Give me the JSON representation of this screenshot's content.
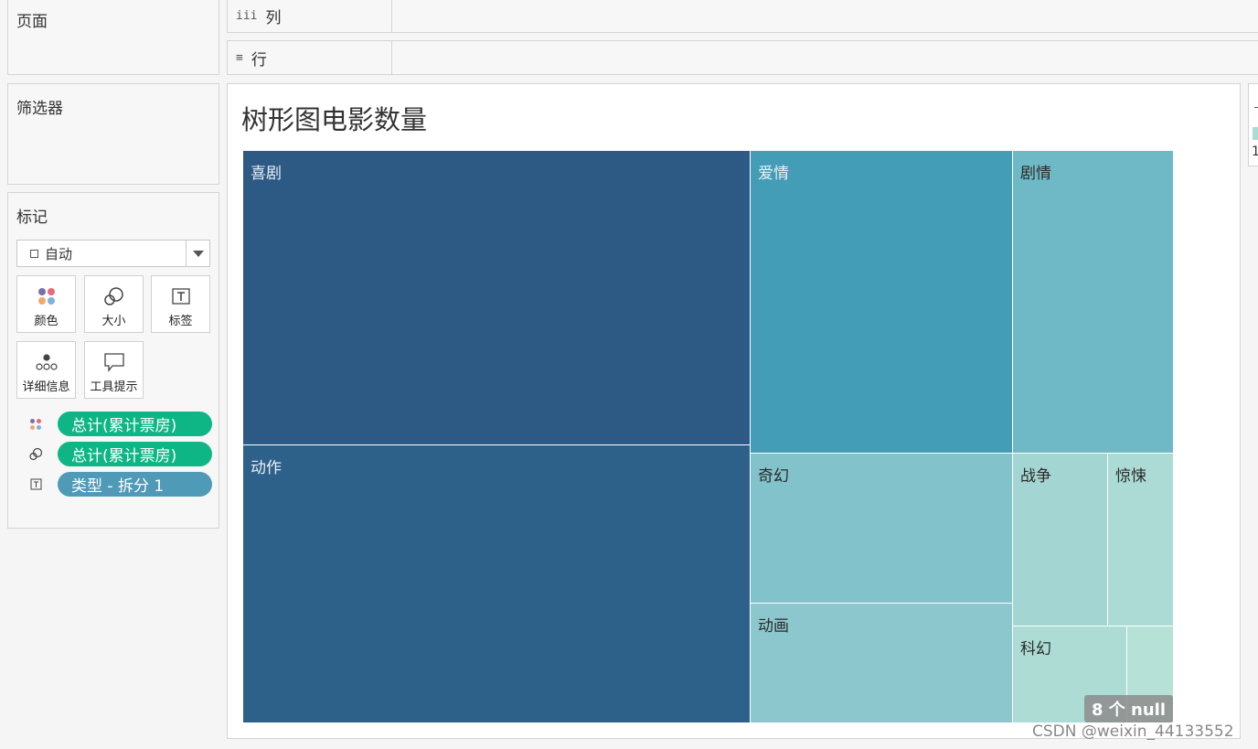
{
  "panels": {
    "pages": "页面",
    "filters": "筛选器",
    "marks": "标记"
  },
  "shelves": {
    "columns": "列",
    "rows": "行"
  },
  "marks": {
    "type": "自动",
    "buttons": [
      "颜色",
      "大小",
      "标签",
      "详细信息",
      "工具提示"
    ],
    "fields": [
      {
        "label": "总计(累计票房)",
        "kind": "color"
      },
      {
        "label": "总计(累计票房)",
        "kind": "size"
      },
      {
        "label": "类型 - 拆分 1",
        "kind": "label"
      }
    ]
  },
  "viz": {
    "title": "树形图电影数量",
    "null_badge": "8 个 null"
  },
  "legend": {
    "number": "1"
  },
  "watermark": "CSDN @weixin_44133552",
  "chart_data": {
    "type": "treemap",
    "title": "树形图电影数量",
    "items": [
      {
        "label": "喜剧",
        "color": "#2d5a85"
      },
      {
        "label": "动作",
        "color": "#2e618a"
      },
      {
        "label": "爱情",
        "color": "#449db7"
      },
      {
        "label": "剧情",
        "color": "#6fb9c6"
      },
      {
        "label": "奇幻",
        "color": "#82c2ca"
      },
      {
        "label": "动画",
        "color": "#8cc7cd"
      },
      {
        "label": "战争",
        "color": "#a3d6d2"
      },
      {
        "label": "惊悚",
        "color": "#abdbd4"
      },
      {
        "label": "科幻",
        "color": "#acdcd4"
      },
      {
        "label": "",
        "color": "#b5e1d7"
      }
    ]
  }
}
